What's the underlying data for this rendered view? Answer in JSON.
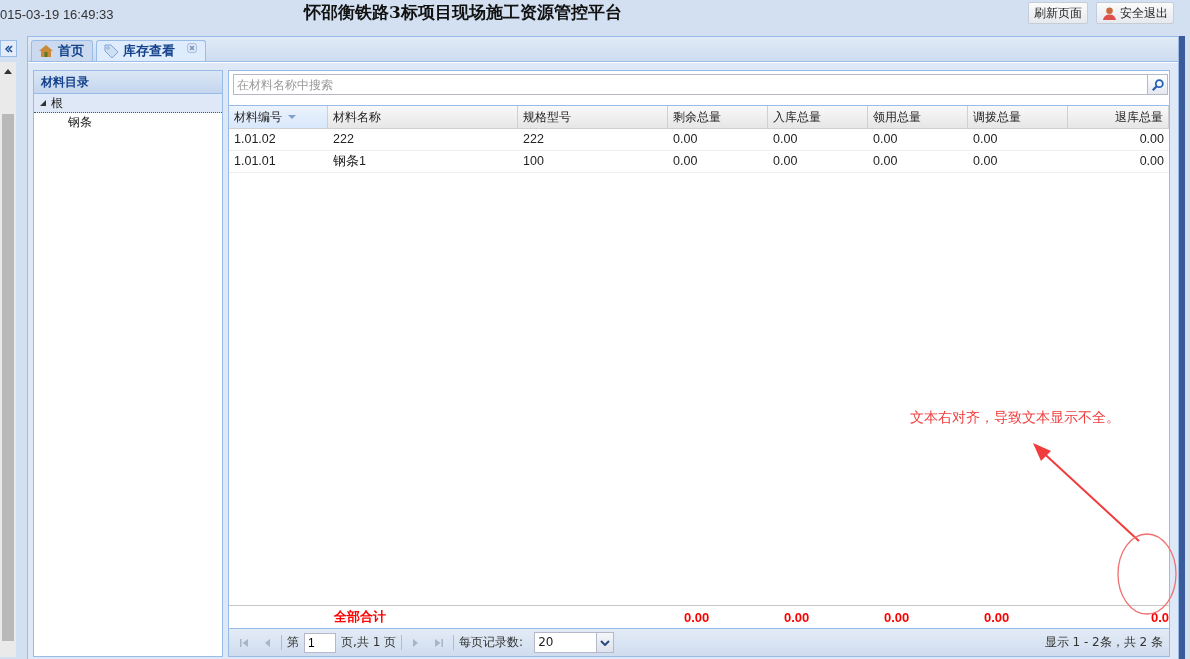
{
  "header": {
    "datetime": "015-03-19 16:49:33",
    "title": "怀邵衡铁路3标项目现场施工资源管控平台",
    "buttons": [
      {
        "kind": "plain",
        "label": "刷新页面"
      },
      {
        "kind": "user",
        "label": "安全退出"
      }
    ]
  },
  "tabs": [
    {
      "kind": "home",
      "label": "首页",
      "selected": false,
      "closable": false
    },
    {
      "kind": "tag",
      "label": "库存查看",
      "selected": true,
      "closable": true
    }
  ],
  "tree": {
    "title": "材料目录",
    "nodes": [
      {
        "label": "根",
        "expanded": true,
        "children": [
          {
            "label": "钢条"
          }
        ]
      }
    ]
  },
  "grid": {
    "search": {
      "placeholder": "在材料名称中搜索"
    },
    "columns": [
      {
        "label": "材料编号",
        "sorted": true,
        "right_aligned": false
      },
      {
        "label": "材料名称",
        "sorted": false,
        "right_aligned": false
      },
      {
        "label": "规格型号",
        "sorted": false,
        "right_aligned": false
      },
      {
        "label": "剩余总量",
        "sorted": false,
        "right_aligned": false
      },
      {
        "label": "入库总量",
        "sorted": false,
        "right_aligned": false
      },
      {
        "label": "领用总量",
        "sorted": false,
        "right_aligned": false
      },
      {
        "label": "调拨总量",
        "sorted": false,
        "right_aligned": false
      },
      {
        "label": "退库总量",
        "sorted": false,
        "right_aligned": true
      }
    ],
    "rows": [
      [
        "1.01.02",
        "222",
        "222",
        "0.00",
        "0.00",
        "0.00",
        "0.00",
        "0.00"
      ],
      [
        "1.01.01",
        "钢条1",
        "100",
        "0.00",
        "0.00",
        "0.00",
        "0.00",
        "0.00"
      ]
    ],
    "summary": {
      "label": "全部合计",
      "values": [
        "0.00",
        "0.00",
        "0.00",
        "0.00",
        "0.0"
      ]
    },
    "pager": {
      "page_prefix": "第",
      "page": "1",
      "page_suffix": "页,共 1 页",
      "page_size_label": "每页记录数:",
      "page_size": "20",
      "info": "显示 1 - 2条，共 2 条"
    }
  },
  "annotation": {
    "text": "文本右对齐，导致文本显示不全。"
  }
}
